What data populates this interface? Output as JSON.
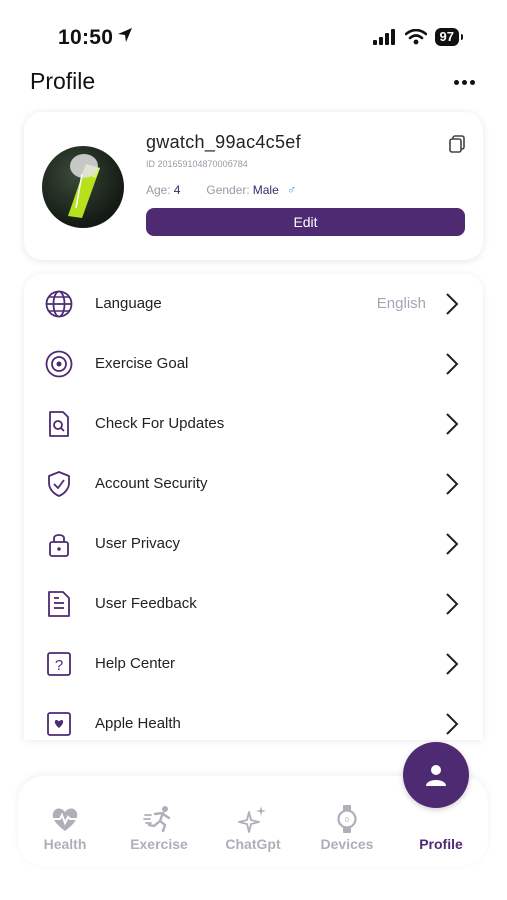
{
  "status_bar": {
    "time": "10:50",
    "battery": "97"
  },
  "header": {
    "title": "Profile"
  },
  "profile": {
    "username": "gwatch_99ac4c5ef",
    "id_text": "ID 20165910487000б784",
    "age_label": "Age:",
    "age_value": "4",
    "gender_label": "Gender:",
    "gender_value": "Male",
    "edit_label": "Edit"
  },
  "menu": {
    "items": [
      {
        "label": "Language",
        "value": "English",
        "icon": "globe-icon"
      },
      {
        "label": "Exercise Goal",
        "icon": "target-icon"
      },
      {
        "label": "Check For Updates",
        "icon": "document-search-icon"
      },
      {
        "label": "Account Security",
        "icon": "shield-check-icon"
      },
      {
        "label": "User Privacy",
        "icon": "lock-icon"
      },
      {
        "label": "User Feedback",
        "icon": "document-lines-icon"
      },
      {
        "label": "Help Center",
        "icon": "help-question-icon"
      },
      {
        "label": "Apple Health",
        "icon": "heart-square-icon"
      }
    ]
  },
  "tabs": [
    {
      "label": "Health",
      "icon": "heart-pulse-icon"
    },
    {
      "label": "Exercise",
      "icon": "running-icon"
    },
    {
      "label": "ChatGpt",
      "icon": "sparkles-icon"
    },
    {
      "label": "Devices",
      "icon": "watch-icon"
    },
    {
      "label": "Profile",
      "icon": "person-icon",
      "active": true
    }
  ],
  "colors": {
    "accent": "#4e2a73",
    "muted": "#b2adb9",
    "male_symbol": "#4aa3e0"
  }
}
